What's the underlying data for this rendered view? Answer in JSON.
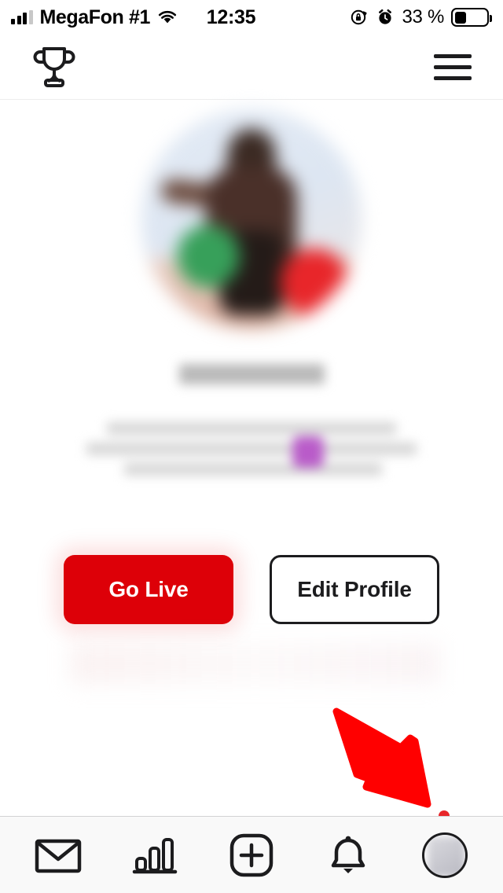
{
  "status_bar": {
    "carrier": "MegaFon #1",
    "signal_icon": "signal-bars-icon",
    "signal_bars_filled": 3,
    "signal_bars_total": 4,
    "wifi_icon": "wifi-icon",
    "time": "12:35",
    "rotation_lock_icon": "rotation-lock-icon",
    "alarm_icon": "alarm-clock-icon",
    "battery_percent": "33 %",
    "battery_level": 33,
    "battery_icon": "battery-icon"
  },
  "header": {
    "trophy_icon": "trophy-icon",
    "menu_icon": "hamburger-menu-icon"
  },
  "profile": {
    "avatar_icon": "profile-avatar-image",
    "avatar_state": "blurred",
    "username": "",
    "username_state": "blurred",
    "bio": "",
    "bio_state": "blurred",
    "bio_emoji_color": "#b95bc9"
  },
  "actions": {
    "go_live_label": "Go Live",
    "edit_profile_label": "Edit Profile",
    "go_live_color": "#dd0008",
    "edit_profile_border_color": "#1c1c1e"
  },
  "annotation": {
    "arrow_icon": "red-arrow-pointing-down-right",
    "arrow_color": "#ff0000",
    "points_to": "nav-item-profile"
  },
  "bottom_nav": {
    "items": [
      {
        "name": "messages",
        "icon": "envelope-icon",
        "label": ""
      },
      {
        "name": "stats",
        "icon": "bar-chart-icon",
        "label": ""
      },
      {
        "name": "create",
        "icon": "plus-square-icon",
        "label": ""
      },
      {
        "name": "notifications",
        "icon": "bell-icon",
        "label": ""
      },
      {
        "name": "profile",
        "icon": "avatar-icon",
        "label": ""
      }
    ]
  }
}
